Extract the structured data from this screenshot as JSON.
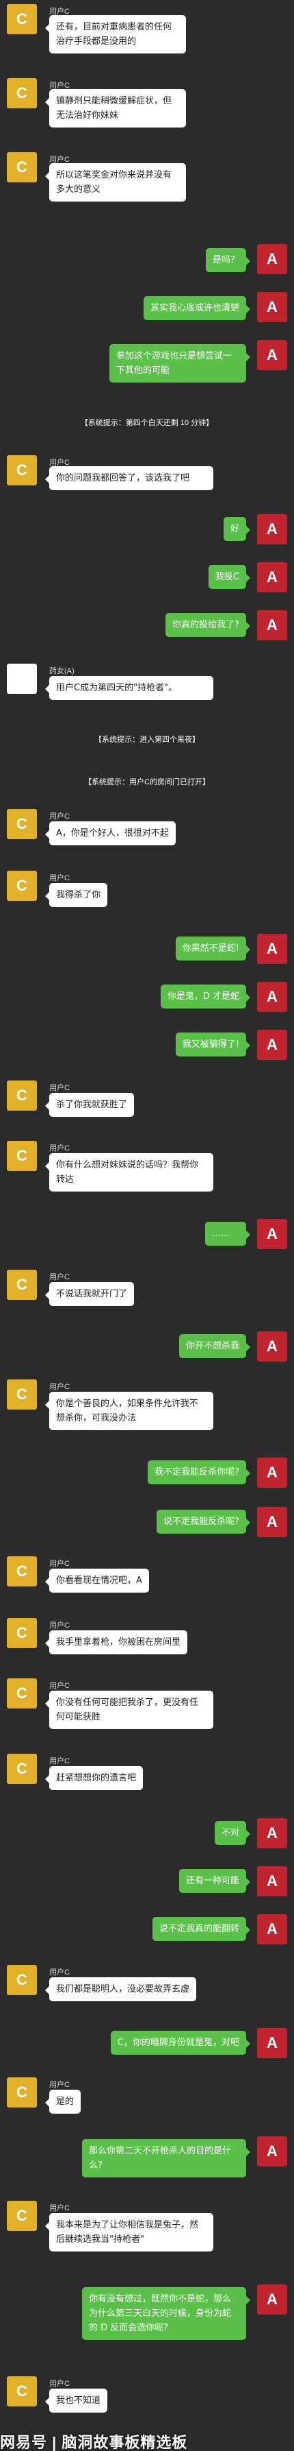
{
  "user_name": "用户C",
  "sender_a_initial": "A",
  "sender_c_initial": "C",
  "boy_name": "药女(A)",
  "messages": [
    {
      "text": "还有，目前对重病患者的任何治疗手段都是没用的"
    },
    {
      "text": "镇静剂只能稍微缓解症状，但无法治好你妹妹"
    },
    {
      "text": "所以这笔奖金对你来说并没有多大的意义"
    },
    {
      "text": "是吗？"
    },
    {
      "text": "其实我心底或许也清楚"
    },
    {
      "text": "参加这个游戏也只是想尝试一下其他的可能"
    },
    {
      "text": "【系统提示：第四个白天还剩 10 分钟】"
    },
    {
      "text": "你的问题我都回答了，该选我了吧"
    },
    {
      "text": "好"
    },
    {
      "text": "我投C"
    },
    {
      "text": "你真的投给我了?"
    },
    {
      "text": "用户C成为第四天的\"持枪者\"。"
    },
    {
      "text": "【系统提示：进入第四个黑夜】"
    },
    {
      "text": "【系统提示：用户C的房间门已打开】"
    },
    {
      "text": "A，你是个好人，很很对不起"
    },
    {
      "text": "我得杀了你"
    },
    {
      "text": "你果然不是蛇!"
    },
    {
      "text": "你是鬼，D 才是蛇"
    },
    {
      "text": "我又被骗得了!"
    },
    {
      "text": "杀了你我就获胜了"
    },
    {
      "text": "你有什么想对妹妹说的话吗？我帮你转达"
    },
    {
      "text": "……"
    },
    {
      "text": "不说话我就开门了"
    },
    {
      "text": "你开不想杀我"
    },
    {
      "text": "你是个善良的人，如果条件允许我不想杀你，可我没办法"
    },
    {
      "text": "我不定我能反杀你呢?"
    },
    {
      "text": "说不定我能反杀呢?"
    },
    {
      "text": "你看看现在情况吧，A"
    },
    {
      "text": "我手里拿着枪，你被困在房间里"
    },
    {
      "text": "你没有任何可能把我杀了，更没有任何可能获胜"
    },
    {
      "text": "赶紧想想你的遗言吧"
    },
    {
      "text": "不对"
    },
    {
      "text": "还有一种可能"
    },
    {
      "text": "说不定我真的能翻转"
    },
    {
      "text": "我们都是聪明人，没必要故弄玄虚"
    },
    {
      "text": "C，你的暗牌身份就是鬼，对吧"
    },
    {
      "text": "是的"
    },
    {
      "text": "那么你第二天不开枪杀人的目的是什么?"
    },
    {
      "text": "我本来是为了让你相信我是兔子，然后继续选我当\"持枪者\""
    },
    {
      "text": "你有没有想过，既然你不是蛇，那么为什么第三天白天的时候，身份为蛇的 D 反而会选你呢?"
    },
    {
      "text": "我也不知道"
    }
  ],
  "watermark": "网易号 | 脑洞故事板精选板"
}
